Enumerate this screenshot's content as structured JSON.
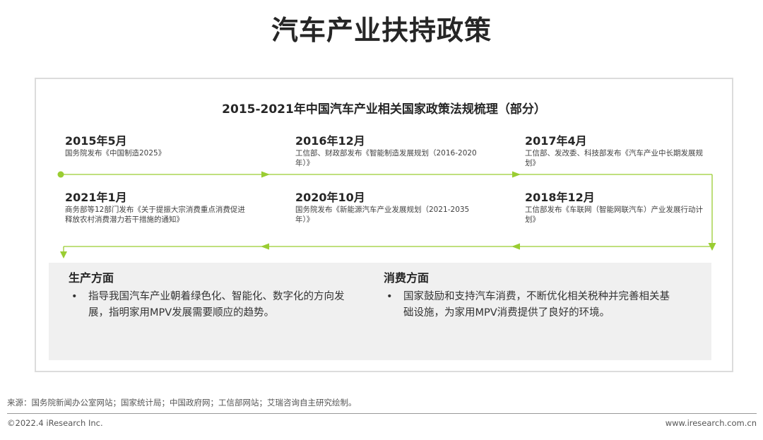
{
  "title": "汽车产业扶持政策",
  "panel": {
    "title": "2015-2021年中国汽车产业相关国家政策法规梳理（部分）",
    "accent_color": "#9acd32",
    "events": [
      {
        "date": "2015年5月",
        "desc": "国务院发布《中国制造2025》"
      },
      {
        "date": "2016年12月",
        "desc": "工信部、财政部发布《智能制造发展规划（2016-2020年）》"
      },
      {
        "date": "2017年4月",
        "desc": "工信部、发改委、科技部发布《汽车产业中长期发展规划》"
      },
      {
        "date": "2021年1月",
        "desc": "商务部等12部门发布《关于提振大宗消费重点消费促进释放农村消费潜力若干措施的通知》"
      },
      {
        "date": "2020年10月",
        "desc": "国务院发布《新能源汽车产业发展规划（2021-2035年）》"
      },
      {
        "date": "2018年12月",
        "desc": "工信部发布《车联网（智能网联汽车）产业发展行动计划》"
      }
    ]
  },
  "aspects": [
    {
      "heading": "生产方面",
      "bullet": "•",
      "text": "指导我国汽车产业朝着绿色化、智能化、数字化的方向发展，指明家用MPV发展需要顺应的趋势。"
    },
    {
      "heading": "消费方面",
      "bullet": "•",
      "text": "国家鼓励和支持汽车消费，不断优化相关税种并完善相关基础设施，为家用MPV消费提供了良好的环境。"
    }
  ],
  "footer": {
    "source": "来源：国务院新闻办公室网站；国家统计局；中国政府网；工信部网站；艾瑞咨询自主研究绘制。",
    "copyright": "©2022.4 iResearch Inc.",
    "website": "www.iresearch.com.cn"
  }
}
